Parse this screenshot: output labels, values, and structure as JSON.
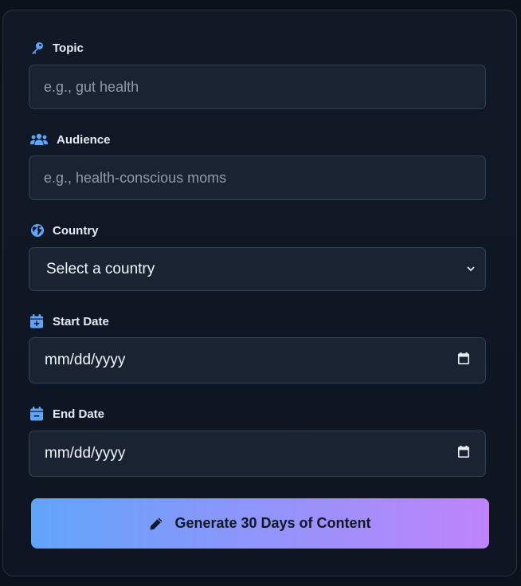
{
  "form": {
    "topic": {
      "label": "Topic",
      "icon": "key-icon",
      "placeholder": "e.g., gut health",
      "value": ""
    },
    "audience": {
      "label": "Audience",
      "icon": "users-icon",
      "placeholder": "e.g., health-conscious moms",
      "value": ""
    },
    "country": {
      "label": "Country",
      "icon": "globe-icon",
      "selected": "Select a country"
    },
    "start_date": {
      "label": "Start Date",
      "icon": "calendar-plus-icon",
      "value": "mm/dd/yyyy"
    },
    "end_date": {
      "label": "End Date",
      "icon": "calendar-minus-icon",
      "value": "mm/dd/yyyy"
    },
    "submit": {
      "label": "Generate 30 Days of Content",
      "icon": "pencil-icon"
    }
  },
  "colors": {
    "accent_icon": "#60a5fa",
    "gradient_start": "#60a5fa",
    "gradient_end": "#c084fc",
    "field_bg": "#1a2332",
    "page_bg": "#0b111b"
  }
}
